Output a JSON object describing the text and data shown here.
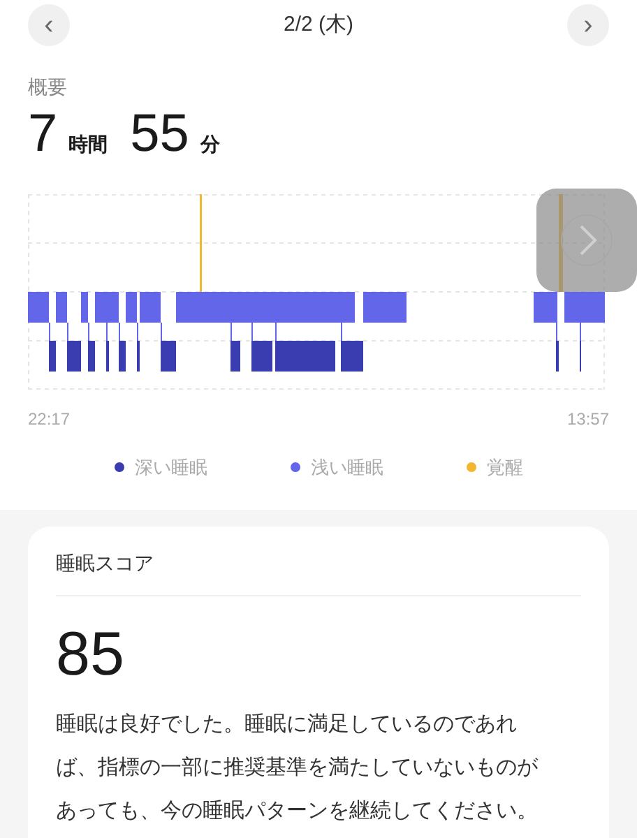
{
  "header": {
    "title": "2/2 (木)",
    "prev_label": "‹",
    "next_label": "›"
  },
  "summary": {
    "label": "概要",
    "hours": "7",
    "hours_unit": "時間",
    "minutes": "55",
    "minutes_unit": "分"
  },
  "chart": {
    "start_time": "22:17",
    "end_time": "13:57"
  },
  "legend": [
    {
      "label": "深い睡眠",
      "color": "#3a3db0"
    },
    {
      "label": "浅い睡眠",
      "color": "#6366e8"
    },
    {
      "label": "覚醒",
      "color": "#f2b630"
    }
  ],
  "score_card": {
    "title": "睡眠スコア",
    "score": "85",
    "description": "睡眠は良好でした。睡眠に満足しているのであれば、指標の一部に推奨基準を満たしていないものがあっても、今の睡眠パターンを継続してください。"
  }
}
